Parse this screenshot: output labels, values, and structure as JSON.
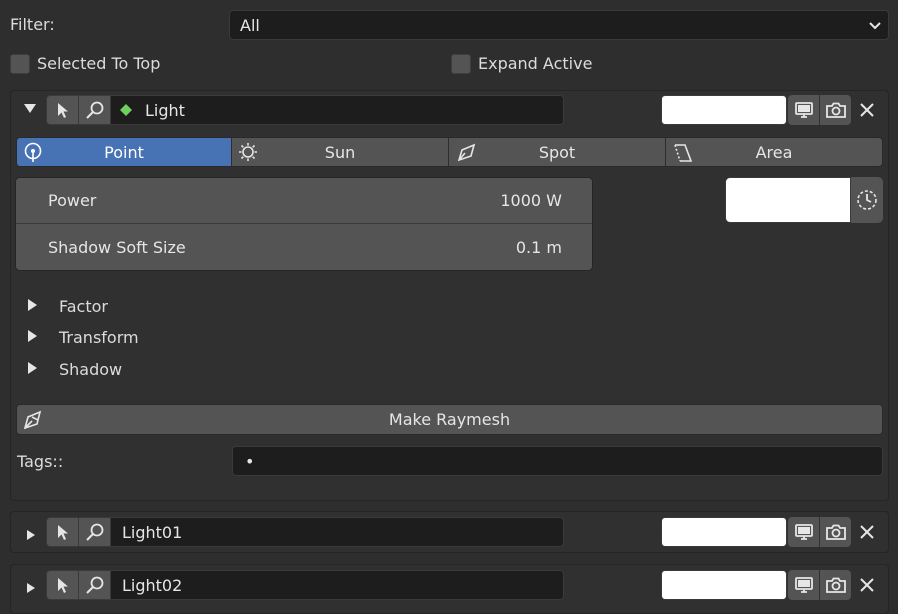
{
  "filter": {
    "label": "Filter:",
    "value": "All"
  },
  "options": {
    "selected_to_top": "Selected To Top",
    "expand_active": "Expand Active"
  },
  "lights": [
    {
      "name": "Light",
      "expanded": true
    },
    {
      "name": "Light01",
      "expanded": false
    },
    {
      "name": "Light02",
      "expanded": false
    }
  ],
  "light_types": [
    "Point",
    "Sun",
    "Spot",
    "Area"
  ],
  "active_type": "Point",
  "properties": [
    {
      "label": "Power",
      "value": "1000 W"
    },
    {
      "label": "Shadow Soft Size",
      "value": "0.1 m"
    }
  ],
  "subpanels": [
    "Factor",
    "Transform",
    "Shadow"
  ],
  "make_button": "Make Raymesh",
  "tags": {
    "label": "Tags::",
    "value": "•"
  },
  "colors": {
    "accent": "#4772b3",
    "panel": "#303030",
    "field": "#1d1d1d",
    "button": "#545454",
    "object_icon": "#6fcf5f"
  }
}
